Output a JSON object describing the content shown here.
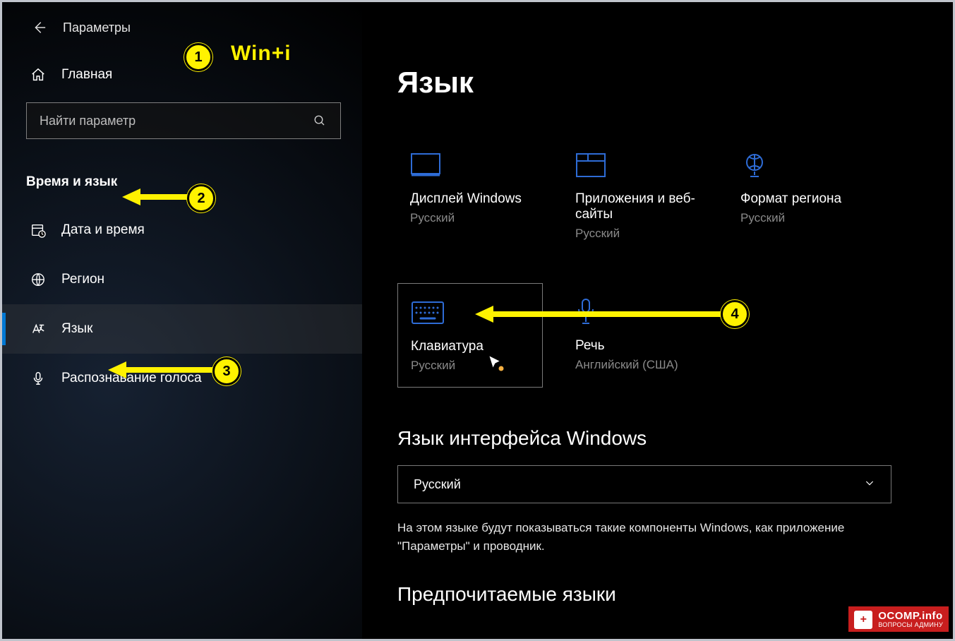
{
  "app_title": "Параметры",
  "home_label": "Главная",
  "search_placeholder": "Найти параметр",
  "section_title": "Время и язык",
  "nav": [
    {
      "key": "datetime",
      "label": "Дата и время"
    },
    {
      "key": "region",
      "label": "Регион"
    },
    {
      "key": "language",
      "label": "Язык",
      "active": true
    },
    {
      "key": "speech",
      "label": "Распознавание голоса"
    }
  ],
  "page_title": "Язык",
  "tiles": [
    {
      "key": "display",
      "title": "Дисплей Windows",
      "sub": "Русский"
    },
    {
      "key": "apps",
      "title": "Приложения и веб-сайты",
      "sub": "Русский"
    },
    {
      "key": "region",
      "title": "Формат региона",
      "sub": "Русский"
    },
    {
      "key": "keyboard",
      "title": "Клавиатура",
      "sub": "Русский",
      "selected": true
    },
    {
      "key": "speech",
      "title": "Речь",
      "sub": "Английский (США)"
    }
  ],
  "interface_lang_heading": "Язык интерфейса Windows",
  "interface_lang_value": "Русский",
  "interface_lang_desc": "На этом языке будут показываться такие компоненты Windows, как приложение \"Параметры\" и проводник.",
  "preferred_heading": "Предпочитаемые языки",
  "annotations": {
    "tip1_text": "Win+i",
    "m1": "1",
    "m2": "2",
    "m3": "3",
    "m4": "4"
  },
  "watermark": {
    "line1": "OCOMP.info",
    "line2": "ВОПРОСЫ АДМИНУ"
  }
}
